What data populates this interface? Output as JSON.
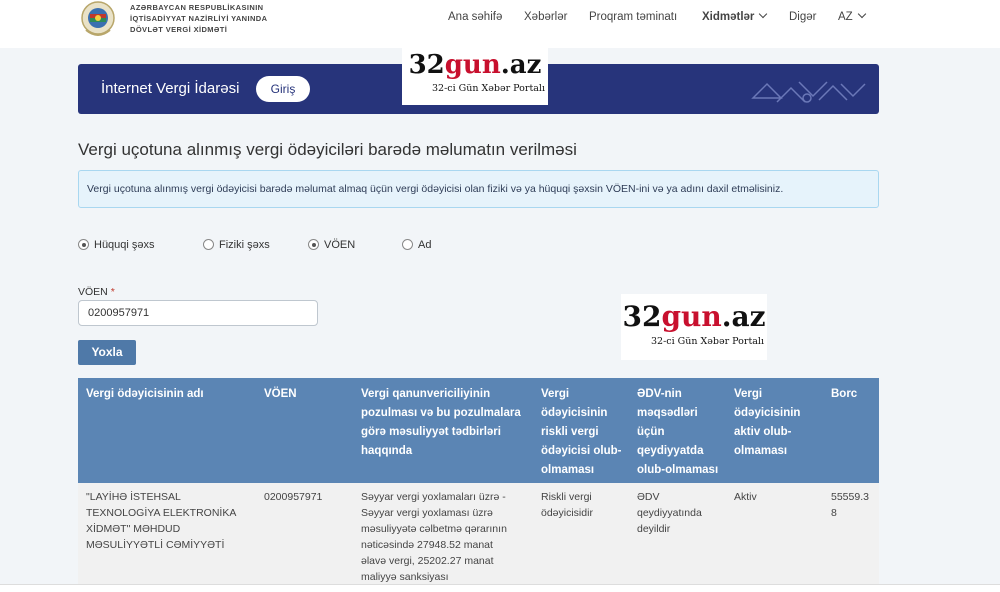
{
  "header": {
    "org_lines": [
      "AZƏRBAYCAN RESPUBLİKASININ",
      "İQTİSADİYYAT NAZİRLİYİ YANINDA",
      "DÖVLƏT VERGİ XİDMƏTİ"
    ],
    "nav": {
      "home": "Ana səhifə",
      "news": "Xəbərlər",
      "software": "Proqram təminatı",
      "services": "Xidmətlər",
      "other": "Digər",
      "lang": "AZ"
    }
  },
  "banner": {
    "title": "İnternet Vergi İdarəsi",
    "login_label": "Giriş"
  },
  "watermark": {
    "brand_a": "32",
    "brand_b": "gun",
    "brand_c": ".az",
    "tagline": "32-ci Gün Xəbər Portalı"
  },
  "page": {
    "title": "Vergi uçotuna alınmış vergi ödəyiciləri barədə məlumatın verilməsi",
    "info": "Vergi uçotuna alınmış vergi ödəyicisi barədə məlumat almaq üçün vergi ödəyicisi olan fiziki və ya hüquqi şəxsin VÖEN-ini və ya adını daxil etməlisiniz."
  },
  "radios": {
    "legal": "Hüquqi şəxs",
    "physical": "Fiziki şəxs",
    "voen": "VÖEN",
    "name": "Ad"
  },
  "form": {
    "voen_label": "VÖEN",
    "required_mark": "*",
    "voen_value": "0200957971",
    "search_label": "Yoxla"
  },
  "table": {
    "headers": {
      "name": [
        "Vergi ödəyicisinin adı"
      ],
      "voen": [
        "VÖEN"
      ],
      "violations": [
        "Vergi qanunvericiliyinin",
        "pozulması və bu pozulmalara",
        "görə məsuliyyət tədbirləri",
        "haqqında"
      ],
      "risky": [
        "Vergi",
        "ödəyicisinin",
        "riskli vergi",
        "ödəyicisi olub-",
        "olmaması"
      ],
      "vat": [
        "ƏDV-nin",
        "məqsədləri",
        "üçün",
        "qeydiyyatda",
        "olub-olmaması"
      ],
      "active": [
        "Vergi",
        "ödəyicisinin",
        "aktiv olub-",
        "olmaması"
      ],
      "debt": [
        "Borc"
      ]
    },
    "row": {
      "name": [
        "\"LAYİHƏ İSTEHSAL",
        "TEXNOLOGİYA ELEKTRONİKA",
        "XİDMƏT\" MƏHDUD",
        "MƏSULİYYƏTLİ CƏMİYYƏTİ"
      ],
      "voen": [
        "0200957971"
      ],
      "violations": [
        "Səyyar vergi yoxlamaları üzrə -",
        "Səyyar vergi yoxlaması üzrə",
        "məsuliyyətə cəlbetmə qərarının",
        "nəticəsində 27948.52 manat",
        "əlavə vergi, 25202.27 manat",
        "maliyyə sanksiyası"
      ],
      "risky": [
        "Riskli vergi",
        "ödəyicisidir"
      ],
      "vat": [
        "ƏDV",
        "qeydiyyatında",
        "deyildir"
      ],
      "active": [
        "Aktiv"
      ],
      "debt": [
        "55559.3",
        "8"
      ]
    }
  },
  "colors": {
    "banner": "#27347b",
    "table_header": "#5b85b4",
    "button": "#4f79a8",
    "info_bg": "#e6f3fb",
    "watermark_red": "#c8102e"
  }
}
